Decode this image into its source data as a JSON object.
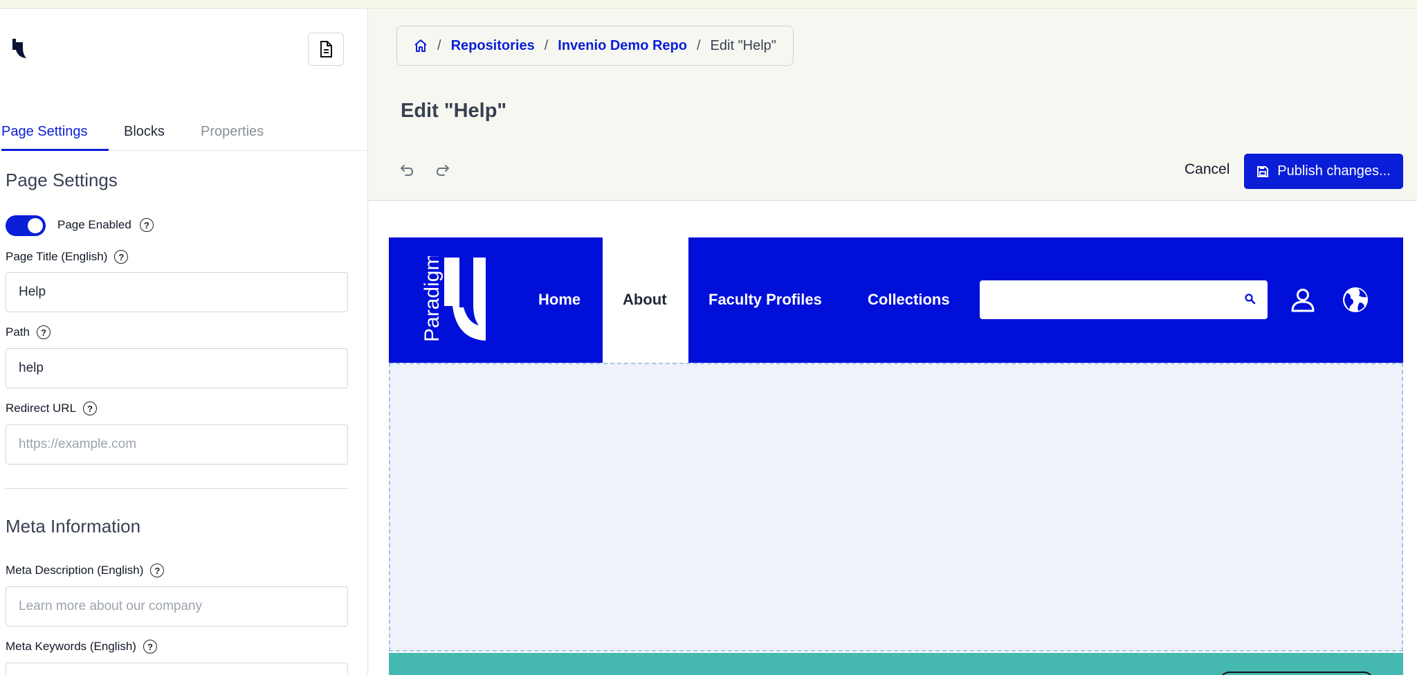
{
  "sidebar": {
    "tabs": [
      {
        "label": "Page Settings",
        "state": "active"
      },
      {
        "label": "Blocks",
        "state": "normal"
      },
      {
        "label": "Properties",
        "state": "muted"
      }
    ],
    "page_settings": {
      "title": "Page Settings",
      "enabled_label": "Page Enabled",
      "enabled": true,
      "page_title_label": "Page Title (English)",
      "page_title_value": "Help",
      "path_label": "Path",
      "path_value": "help",
      "redirect_label": "Redirect URL",
      "redirect_placeholder": "https://example.com"
    },
    "meta": {
      "title": "Meta Information",
      "description_label": "Meta Description (English)",
      "description_placeholder": "Learn more about our company",
      "keywords_label": "Meta Keywords (English)"
    }
  },
  "header": {
    "breadcrumb": {
      "items": [
        "Repositories",
        "Invenio Demo Repo"
      ],
      "current": "Edit \"Help\"",
      "separator": "/"
    },
    "page_heading": "Edit \"Help\"",
    "cancel_label": "Cancel",
    "publish_label": "Publish changes..."
  },
  "preview": {
    "logo_text": "Paradigm",
    "nav": [
      "Home",
      "About",
      "Faculty Profiles",
      "Collections"
    ],
    "active_nav": "About",
    "colors": {
      "header_bg": "#0010d9",
      "accent": "#0a1ed8",
      "footer": "#45b9b0",
      "drop_zone": "#eff2fb"
    }
  },
  "icons": {
    "home": "home-icon",
    "document": "document-icon",
    "undo": "undo-icon",
    "redo": "redo-icon",
    "save": "save-icon",
    "help": "help-icon",
    "search": "search-icon",
    "user": "user-icon",
    "globe": "globe-icon"
  }
}
